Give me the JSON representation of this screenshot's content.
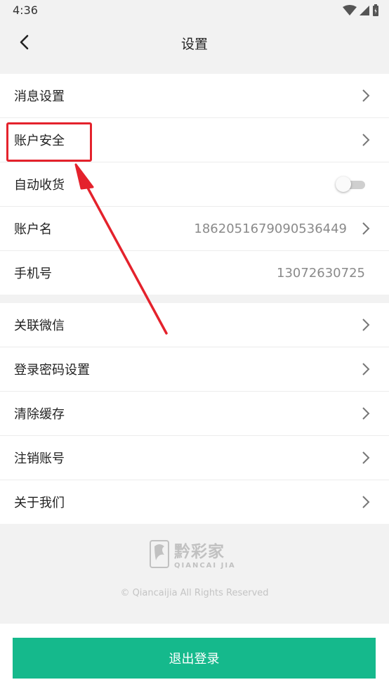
{
  "status_bar": {
    "time": "4:36"
  },
  "header": {
    "title": "设置"
  },
  "group1": [
    {
      "label": "消息设置",
      "value": "",
      "control": "chevron"
    },
    {
      "label": "账户安全",
      "value": "",
      "control": "chevron"
    },
    {
      "label": "自动收货",
      "value": "",
      "control": "toggle"
    },
    {
      "label": "账户名",
      "value": "186205167909053644​9",
      "control": "chevron"
    },
    {
      "label": "手机号",
      "value": "13072630725",
      "control": "none"
    }
  ],
  "group2": [
    {
      "label": "关联微信",
      "control": "chevron"
    },
    {
      "label": "登录密码设置",
      "control": "chevron"
    },
    {
      "label": "清除缓存",
      "control": "chevron"
    },
    {
      "label": "注销账号",
      "control": "chevron"
    },
    {
      "label": "关于我们",
      "control": "chevron"
    }
  ],
  "auto_receive_enabled": false,
  "footer": {
    "brand_cn": "黔彩家",
    "brand_en": "QIANCAI JIA",
    "copyright": "© Qiancaijia All Rights Reserved"
  },
  "logout_label": "退出登录",
  "colors": {
    "accent": "#15b98c",
    "annotation": "#e4222c"
  }
}
